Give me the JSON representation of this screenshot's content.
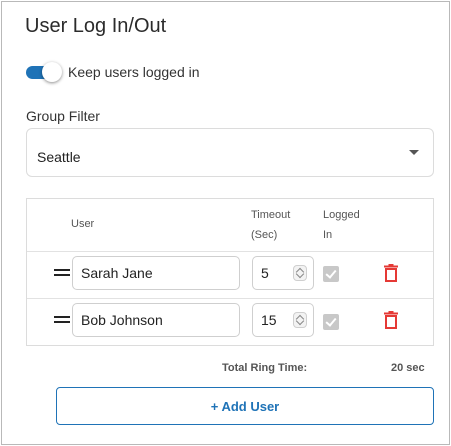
{
  "title": "User Log In/Out",
  "keep_logged_in": {
    "label": "Keep users logged in",
    "checked": true
  },
  "group_filter": {
    "label": "Group Filter",
    "value": "Seattle"
  },
  "table": {
    "headers": {
      "user": "User",
      "timeout_line1": "Timeout",
      "timeout_line2": "(Sec)",
      "logged_in_line1": "Logged",
      "logged_in_line2": "In"
    },
    "rows": [
      {
        "user": "Sarah Jane",
        "timeout": "5",
        "logged_in": true
      },
      {
        "user": "Bob Johnson",
        "timeout": "15",
        "logged_in": true
      }
    ]
  },
  "total": {
    "label": "Total Ring Time:",
    "value": "20 sec"
  },
  "add_user_label": "+ Add User",
  "colors": {
    "accent": "#1f73b7",
    "delete": "#e53935",
    "checkbox": "#c8c8c8"
  },
  "icons": {
    "drag": "drag-handle-icon",
    "delete": "trash-icon",
    "dropdown": "chevron-down-icon"
  }
}
